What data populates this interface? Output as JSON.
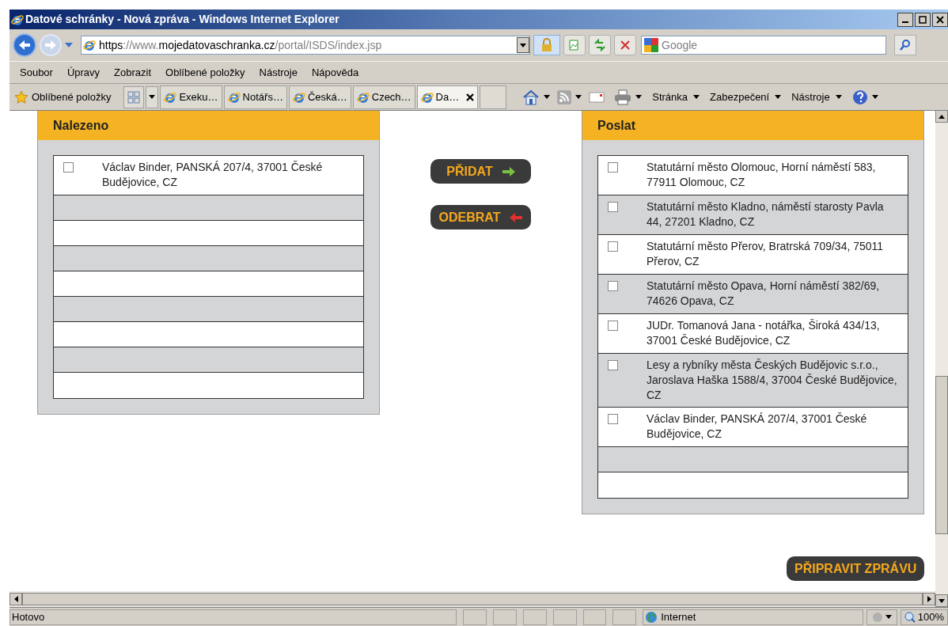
{
  "window": {
    "title": "Datové schránky - Nová zpráva - Windows Internet Explorer"
  },
  "address_bar": {
    "url_parts": [
      {
        "text": "https",
        "emphasis": true
      },
      {
        "text": "://www.",
        "emphasis": false
      },
      {
        "text": "mojedatovaschranka.cz",
        "emphasis": true
      },
      {
        "text": "/portal/ISDS/index.jsp",
        "emphasis": false
      }
    ]
  },
  "search": {
    "placeholder": "Google"
  },
  "menu": [
    "Soubor",
    "Úpravy",
    "Zobrazit",
    "Oblíbené položky",
    "Nástroje",
    "Nápověda"
  ],
  "favorites": {
    "label": "Oblíbené položky"
  },
  "tabs": [
    {
      "label": "Exeku…",
      "selected": false
    },
    {
      "label": "Notářs…",
      "selected": false
    },
    {
      "label": "Česká…",
      "selected": false
    },
    {
      "label": "Czech…",
      "selected": false
    },
    {
      "label": "Da…",
      "selected": true
    }
  ],
  "command_bar": [
    "Stránka",
    "Zabezpečení",
    "Nástroje"
  ],
  "found_panel": {
    "title": "Nalezeno",
    "items": [
      {
        "text": "Václav Binder, PANSKÁ 207/4, 37001 České Budějovice, CZ",
        "checked": false
      }
    ]
  },
  "buttons": {
    "add": "PŘIDAT",
    "remove": "ODEBRAT",
    "prepare": "PŘIPRAVIT ZPRÁVU"
  },
  "send_panel": {
    "title": "Poslat",
    "items": [
      {
        "text": "Statutární město Olomouc, Horní náměstí 583, 77911 Olomouc, CZ",
        "checked": false
      },
      {
        "text": "Statutární město Kladno, náměstí starosty Pavla 44, 27201 Kladno, CZ",
        "checked": false
      },
      {
        "text": "Statutární město Přerov, Bratrská 709/34, 75011 Přerov, CZ",
        "checked": false
      },
      {
        "text": "Statutární město Opava, Horní náměstí 382/69, 74626 Opava, CZ",
        "checked": false
      },
      {
        "text": "JUDr. Tomanová Jana - notářka, Široká 434/13, 37001 České Budějovice, CZ",
        "checked": false
      },
      {
        "text": "Lesy a rybníky města Českých Budějovic s.r.o., Jaroslava Haška 1588/4, 37004 České Budějovice, CZ",
        "checked": false
      },
      {
        "text": "Václav Binder, PANSKÁ 207/4, 37001 České Budějovice, CZ",
        "checked": false
      }
    ]
  },
  "status_bar": {
    "text": "Hotovo",
    "zone": "Internet",
    "zoom": "100%"
  }
}
